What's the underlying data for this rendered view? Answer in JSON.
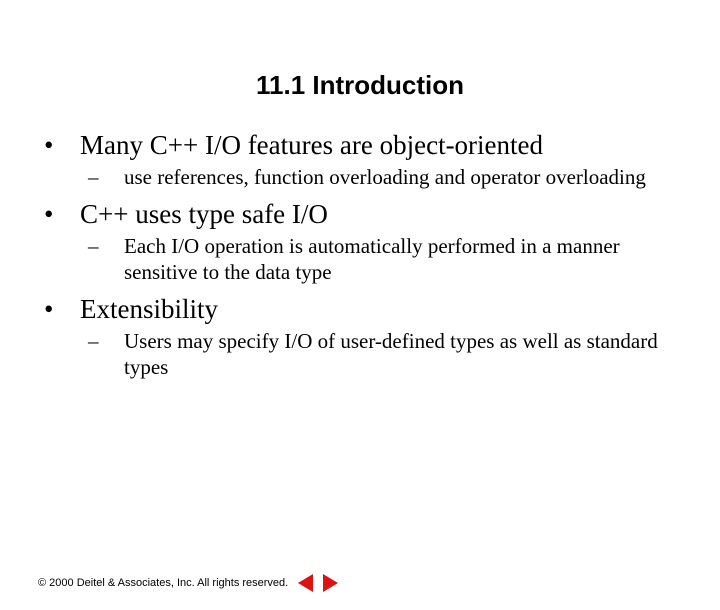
{
  "title": "11.1 Introduction",
  "bullets": {
    "b1": "Many C++ I/O features are object-oriented",
    "b1s1": "use references, function overloading and operator overloading",
    "b2": "C++ uses type safe I/O",
    "b2s1": "Each I/O operation is automatically performed in a manner sensitive to the data type",
    "b3": "Extensibility",
    "b3s1": "Users may specify I/O of user-defined types as well as standard types"
  },
  "footer": {
    "copyright": "© 2000 Deitel & Associates, Inc.  All rights reserved."
  }
}
